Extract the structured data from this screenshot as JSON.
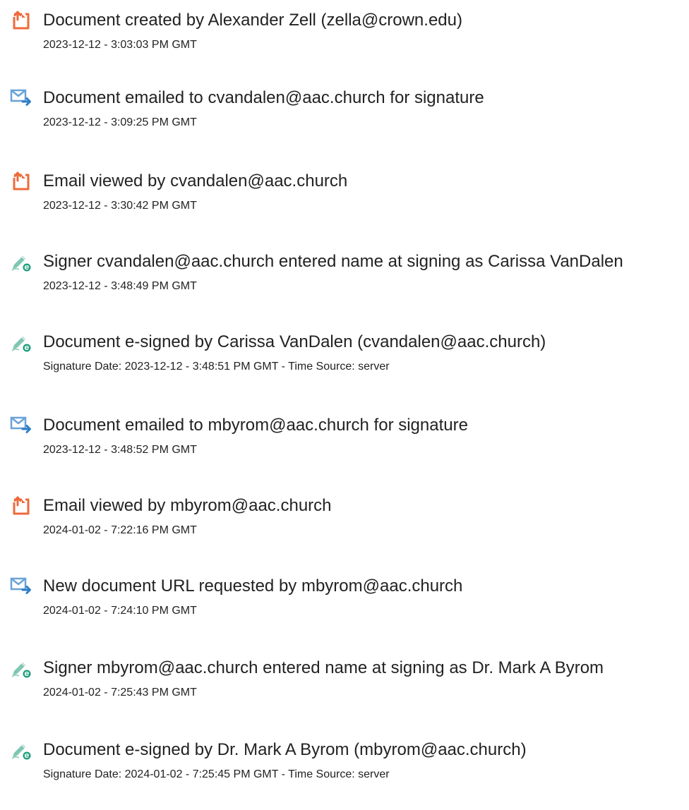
{
  "colors": {
    "created_icon": "#ef6a3a",
    "email_icon": "#6aa2d8",
    "email_arrow": "#2f7fc6",
    "sign_pen": "#7fc6b3",
    "sign_badge": "#1a9c7a",
    "text": "#222222"
  },
  "events": [
    {
      "icon": "document-created-icon",
      "title": "Document created by Alexander Zell (zella@crown.edu)",
      "time": "2023-12-12 - 3:03:03 PM GMT"
    },
    {
      "icon": "email-sent-icon",
      "title": "Document emailed to cvandalen@aac.church for signature",
      "time": "2023-12-12 - 3:09:25 PM GMT"
    },
    {
      "icon": "document-viewed-icon",
      "title": "Email viewed by cvandalen@aac.church",
      "time": "2023-12-12 - 3:30:42 PM GMT"
    },
    {
      "icon": "signature-icon",
      "title": "Signer cvandalen@aac.church entered name at signing as Carissa VanDalen",
      "time": "2023-12-12 - 3:48:49 PM GMT"
    },
    {
      "icon": "signature-icon",
      "title": "Document e-signed by Carissa VanDalen (cvandalen@aac.church)",
      "time": "Signature Date: 2023-12-12 - 3:48:51 PM GMT - Time Source: server"
    },
    {
      "icon": "email-sent-icon",
      "title": "Document emailed to mbyrom@aac.church for signature",
      "time": "2023-12-12 - 3:48:52 PM GMT"
    },
    {
      "icon": "document-viewed-icon",
      "title": "Email viewed by mbyrom@aac.church",
      "time": "2024-01-02 - 7:22:16 PM GMT"
    },
    {
      "icon": "email-sent-icon",
      "title": "New document URL requested by mbyrom@aac.church",
      "time": "2024-01-02 - 7:24:10 PM GMT"
    },
    {
      "icon": "signature-icon",
      "title": "Signer mbyrom@aac.church entered name at signing as Dr. Mark A Byrom",
      "time": "2024-01-02 - 7:25:43 PM GMT"
    },
    {
      "icon": "signature-icon",
      "title": "Document e-signed by Dr. Mark A Byrom (mbyrom@aac.church)",
      "time": "Signature Date: 2024-01-02 - 7:25:45 PM GMT - Time Source: server"
    }
  ]
}
